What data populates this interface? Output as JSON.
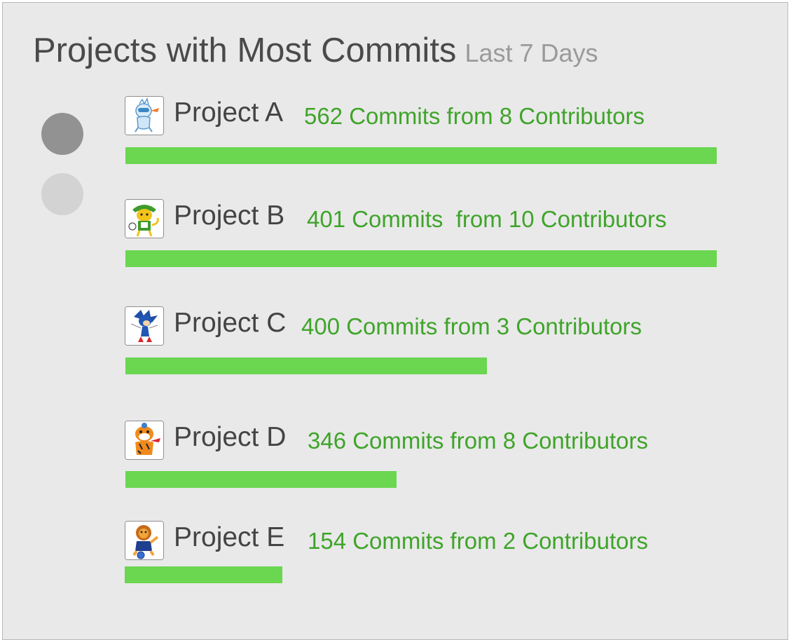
{
  "title": "Projects with Most Commits",
  "subtitle": "Last 7 Days",
  "colors": {
    "bar": "#6bd650",
    "stats_text": "#3fa42a",
    "panel_bg": "#e9e9e9",
    "dot_active": "#929292",
    "dot_inactive": "#d3d3d3"
  },
  "pager": {
    "pages": 2,
    "active_page": 1
  },
  "projects": [
    {
      "name": "Project A",
      "stats": "562 Commits from 8 Contributors",
      "bar_fraction": 1.0,
      "icon": "ice-mascot-icon"
    },
    {
      "name": "Project B",
      "stats": "401 Commits  from 10 Contributors",
      "bar_fraction": 1.0,
      "icon": "leopard-mascot-icon"
    },
    {
      "name": "Project C",
      "stats": "400 Commits from 3 Contributors",
      "bar_fraction": 0.611,
      "icon": "hedgehog-mascot-icon"
    },
    {
      "name": "Project D",
      "stats": "346 Commits from 8 Contributors",
      "bar_fraction": 0.459,
      "icon": "tiger-mascot-icon"
    },
    {
      "name": "Project E",
      "stats": "154 Commits from 2 Contributors",
      "bar_fraction": 0.267,
      "icon": "lion-mascot-icon"
    }
  ]
}
